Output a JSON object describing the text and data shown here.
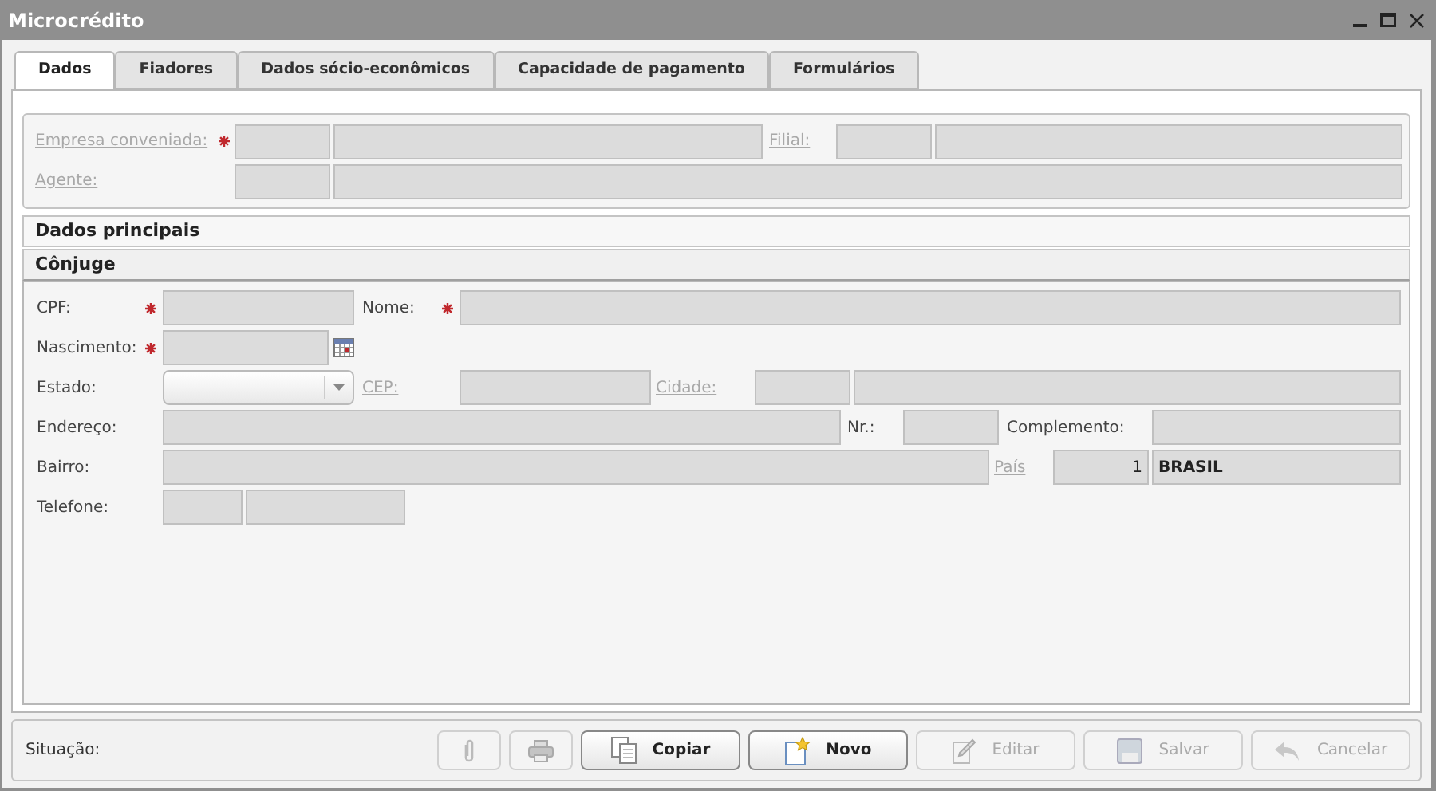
{
  "window": {
    "title": "Microcrédito"
  },
  "tabs": [
    {
      "label": "Dados",
      "selected": true
    },
    {
      "label": "Fiadores",
      "selected": false
    },
    {
      "label": "Dados sócio-econômicos",
      "selected": false
    },
    {
      "label": "Capacidade de pagamento",
      "selected": false
    },
    {
      "label": "Formulários",
      "selected": false
    }
  ],
  "company": {
    "label": "Empresa conveniada:",
    "link": true,
    "required": true
  },
  "branch": {
    "label": "Filial:",
    "link": true
  },
  "agent": {
    "label": "Agente:",
    "link": true
  },
  "sections": [
    {
      "title": "Dados principais",
      "expanded": false
    },
    {
      "title": "Cônjuge",
      "expanded": true
    }
  ],
  "spouse": {
    "cpf": {
      "label": "CPF:",
      "required": true
    },
    "name": {
      "label": "Nome:",
      "required": true
    },
    "birth": {
      "label": "Nascimento:",
      "required": true
    },
    "state": {
      "label": "Estado:"
    },
    "cep": {
      "label": "CEP:",
      "link": true
    },
    "city": {
      "label": "Cidade:",
      "link": true
    },
    "address": {
      "label": "Endereço:"
    },
    "number": {
      "label": "Nr.:"
    },
    "complement": {
      "label": "Complemento:"
    },
    "district": {
      "label": "Bairro:"
    },
    "country": {
      "label": "País",
      "link": true,
      "code": "1",
      "value": "BRASIL"
    },
    "phone": {
      "label": "Telefone:"
    }
  },
  "status": {
    "label": "Situação:"
  },
  "buttons": [
    {
      "kind": "attach",
      "disabled": true
    },
    {
      "kind": "print",
      "disabled": true
    },
    {
      "kind": "copy",
      "label": "Copiar",
      "disabled": false
    },
    {
      "kind": "new",
      "label": "Novo",
      "disabled": false
    },
    {
      "kind": "edit",
      "label": "Editar",
      "disabled": true
    },
    {
      "kind": "save",
      "label": "Salvar",
      "disabled": true
    },
    {
      "kind": "cancel",
      "label": "Cancelar",
      "disabled": true
    }
  ]
}
